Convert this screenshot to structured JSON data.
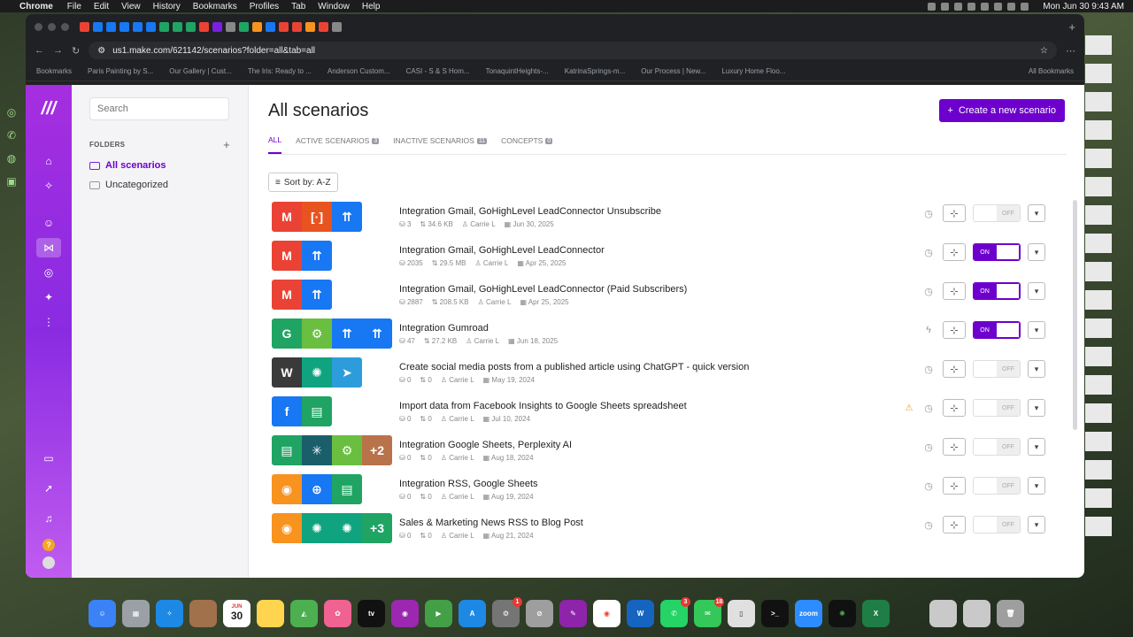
{
  "menubar": {
    "app_name": "Chrome",
    "menus": [
      "File",
      "Edit",
      "View",
      "History",
      "Bookmarks",
      "Profiles",
      "Tab",
      "Window",
      "Help"
    ],
    "clock": "Mon Jun 30  9:43 AM"
  },
  "browser": {
    "url": "us1.make.com/621142/scenarios?folder=all&tab=all",
    "bookmarks": [
      "Bookmarks",
      "Paris Painting by S...",
      "Our Gallery | Cust...",
      "The Iris: Ready to ...",
      "Anderson Custom...",
      "CASI - S & S Hom...",
      "TonaquintHeights-...",
      "KatrinaSprings-m...",
      "Our Process | New...",
      "Luxury Home Floo..."
    ],
    "all_bookmarks": "All Bookmarks"
  },
  "sidebar": {
    "search_placeholder": "Search",
    "folders_label": "FOLDERS",
    "folders": [
      {
        "label": "All scenarios",
        "active": true
      },
      {
        "label": "Uncategorized",
        "active": false
      }
    ]
  },
  "main": {
    "title": "All scenarios",
    "create_label": "Create a new scenario",
    "tabs": [
      {
        "label": "ALL",
        "count": null,
        "active": true
      },
      {
        "label": "ACTIVE SCENARIOS",
        "count": "3",
        "active": false
      },
      {
        "label": "INACTIVE SCENARIOS",
        "count": "11",
        "active": false
      },
      {
        "label": "CONCEPTS",
        "count": "0",
        "active": false
      }
    ],
    "sort_label": "Sort by: A-Z"
  },
  "scenarios": [
    {
      "name": "Integration Gmail, GoHighLevel LeadConnector Unsubscribe",
      "ops": "3",
      "size": "34.6 KB",
      "owner": "Carrie L",
      "date": "Jun 30, 2025",
      "status": "OFF",
      "trigger": "clock",
      "warn": false,
      "apps": [
        {
          "color": "#ea4335",
          "glyph": "M"
        },
        {
          "color": "#e8541f",
          "glyph": "[·]"
        },
        {
          "color": "#1877f2",
          "glyph": "⇈"
        }
      ]
    },
    {
      "name": "Integration Gmail, GoHighLevel LeadConnector",
      "ops": "2035",
      "size": "29.5 MB",
      "owner": "Carrie L",
      "date": "Apr 25, 2025",
      "status": "ON",
      "trigger": "clock",
      "warn": false,
      "apps": [
        {
          "color": "#ea4335",
          "glyph": "M"
        },
        {
          "color": "#1877f2",
          "glyph": "⇈"
        }
      ]
    },
    {
      "name": "Integration Gmail, GoHighLevel LeadConnector (Paid Subscribers)",
      "ops": "2887",
      "size": "208.5 KB",
      "owner": "Carrie L",
      "date": "Apr 25, 2025",
      "status": "ON",
      "trigger": "clock",
      "warn": false,
      "apps": [
        {
          "color": "#ea4335",
          "glyph": "M"
        },
        {
          "color": "#1877f2",
          "glyph": "⇈"
        }
      ]
    },
    {
      "name": "Integration Gumroad",
      "ops": "47",
      "size": "27.2 KB",
      "owner": "Carrie L",
      "date": "Jun 18, 2025",
      "status": "ON",
      "trigger": "bolt",
      "warn": false,
      "apps": [
        {
          "color": "#1fa463",
          "glyph": "G"
        },
        {
          "color": "#6abf40",
          "glyph": "⚙"
        },
        {
          "color": "#1877f2",
          "glyph": "⇈"
        },
        {
          "color": "#1877f2",
          "glyph": "⇈"
        }
      ]
    },
    {
      "name": "Create social media posts from a published article using ChatGPT - quick version",
      "ops": "0",
      "size": "0",
      "owner": "Carrie L",
      "date": "May 19, 2024",
      "status": "OFF",
      "trigger": "clock",
      "warn": false,
      "apps": [
        {
          "color": "#3a3a3a",
          "glyph": "W"
        },
        {
          "color": "#10a37f",
          "glyph": "✺"
        },
        {
          "color": "#2d9cdb",
          "glyph": "➤"
        }
      ]
    },
    {
      "name": "Import data from Facebook Insights to Google Sheets spreadsheet",
      "ops": "0",
      "size": "0",
      "owner": "Carrie L",
      "date": "Jul 10, 2024",
      "status": "OFF",
      "trigger": "clock",
      "warn": true,
      "apps": [
        {
          "color": "#1877f2",
          "glyph": "f"
        },
        {
          "color": "#1fa463",
          "glyph": "▤"
        }
      ]
    },
    {
      "name": "Integration Google Sheets, Perplexity AI",
      "ops": "0",
      "size": "0",
      "owner": "Carrie L",
      "date": "Aug 18, 2024",
      "status": "OFF",
      "trigger": "clock",
      "warn": false,
      "apps": [
        {
          "color": "#1fa463",
          "glyph": "▤"
        },
        {
          "color": "#1b5e6b",
          "glyph": "✳"
        },
        {
          "color": "#6abf40",
          "glyph": "⚙"
        },
        {
          "color": "#b9734a",
          "glyph": "+2"
        }
      ]
    },
    {
      "name": "Integration RSS, Google Sheets",
      "ops": "0",
      "size": "0",
      "owner": "Carrie L",
      "date": "Aug 19, 2024",
      "status": "OFF",
      "trigger": "clock",
      "warn": false,
      "apps": [
        {
          "color": "#f7931e",
          "glyph": "◉"
        },
        {
          "color": "#1877f2",
          "glyph": "⊕"
        },
        {
          "color": "#1fa463",
          "glyph": "▤"
        }
      ]
    },
    {
      "name": "Sales & Marketing News RSS to Blog Post",
      "ops": "0",
      "size": "0",
      "owner": "Carrie L",
      "date": "Aug 21, 2024",
      "status": "OFF",
      "trigger": "clock",
      "warn": false,
      "apps": [
        {
          "color": "#f7931e",
          "glyph": "◉"
        },
        {
          "color": "#10a37f",
          "glyph": "✺"
        },
        {
          "color": "#10a37f",
          "glyph": "✺"
        },
        {
          "color": "#1fa463",
          "glyph": "+3"
        }
      ]
    }
  ],
  "toggle_labels": {
    "on": "ON",
    "off": "OFF"
  },
  "dock": {
    "calendar_month": "JUN",
    "calendar_day": "30",
    "tv_label": "tv",
    "zoom_label": "zoom",
    "badges": {
      "mail": "1",
      "whatsapp": "3",
      "messages": "18"
    }
  },
  "colors": {
    "accent": "#6d00cc",
    "rail_top": "#a52ee0",
    "rail_bottom": "#c05cf0"
  }
}
